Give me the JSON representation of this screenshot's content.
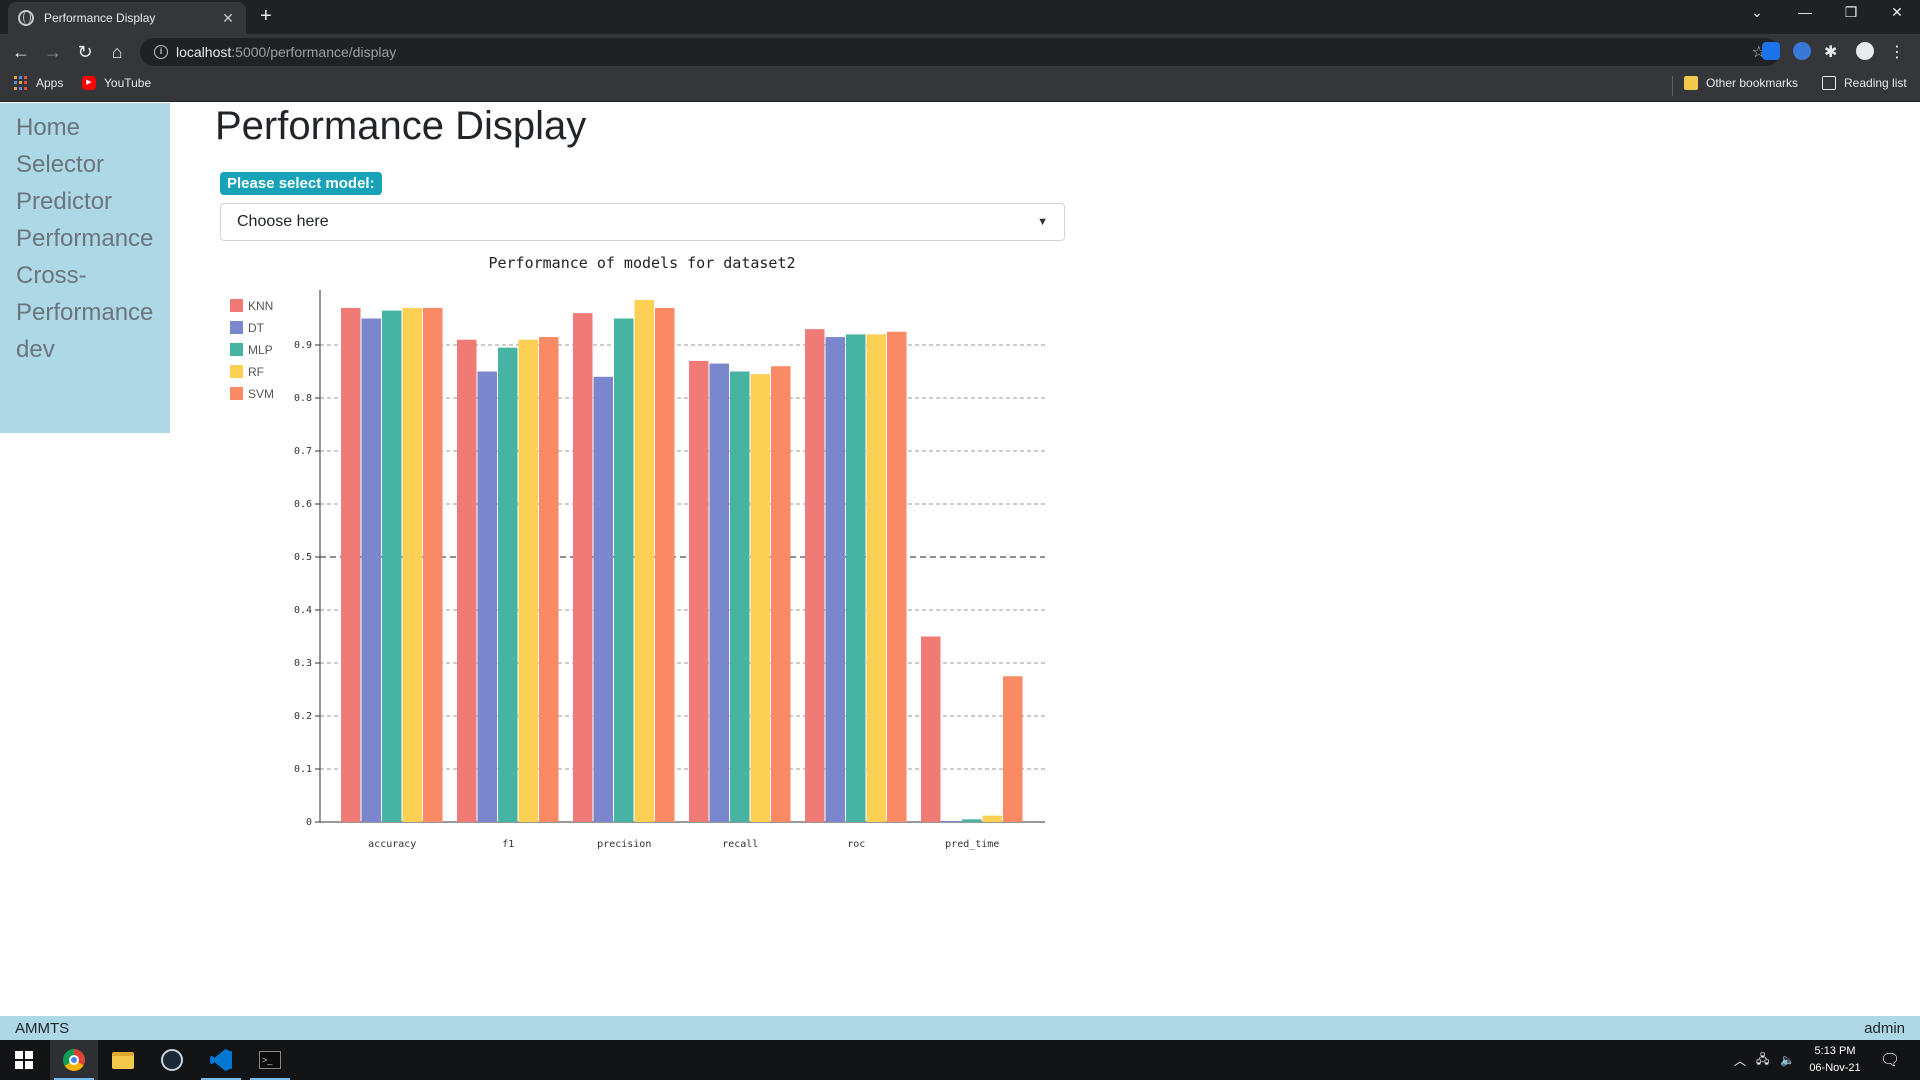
{
  "browser": {
    "tab_title": "Performance Display",
    "tab_close": "✕",
    "new_tab": "+",
    "url_host": "localhost",
    "url_path": ":5000/performance/display",
    "bookmarks": [
      "Apps",
      "YouTube"
    ],
    "other_bookmarks": "Other bookmarks",
    "reading_list": "Reading list"
  },
  "sidebar": {
    "items": [
      "Home",
      "Selector",
      "Predictor",
      "Performance",
      "Cross-",
      "Performance",
      "dev"
    ]
  },
  "page": {
    "title": "Performance Display",
    "select_label": "Please select model:",
    "select_value": "Choose here"
  },
  "footer": {
    "left": "AMMTS",
    "right": "admin"
  },
  "taskbar": {
    "time": "5:13 PM",
    "date": "06-Nov-21"
  },
  "colors": {
    "sidebar_bg": "#add8e6",
    "badge": "#17a2b8",
    "KNN": "#f07a76",
    "DT": "#7a87cc",
    "MLP": "#47b3a3",
    "RF": "#fccf55",
    "SVM": "#fa8a66"
  },
  "chart_data": {
    "type": "bar",
    "title": "Performance of models for dataset2",
    "categories": [
      "accuracy",
      "f1",
      "precision",
      "recall",
      "roc",
      "pred_time"
    ],
    "series": [
      {
        "name": "KNN",
        "values": [
          0.97,
          0.91,
          0.96,
          0.87,
          0.93,
          0.35
        ]
      },
      {
        "name": "DT",
        "values": [
          0.95,
          0.85,
          0.84,
          0.865,
          0.915,
          0.002
        ]
      },
      {
        "name": "MLP",
        "values": [
          0.965,
          0.895,
          0.95,
          0.85,
          0.92,
          0.005
        ]
      },
      {
        "name": "RF",
        "values": [
          0.97,
          0.91,
          0.985,
          0.845,
          0.92,
          0.012
        ]
      },
      {
        "name": "SVM",
        "values": [
          0.97,
          0.915,
          0.97,
          0.86,
          0.925,
          0.275
        ]
      }
    ],
    "yticks": [
      "0",
      "0.1",
      "0.2",
      "0.3",
      "0.4",
      "0.5",
      "0.6",
      "0.7",
      "0.8",
      "0.9"
    ],
    "ylim": [
      0,
      1
    ],
    "legend_position": "top-left",
    "grid": true,
    "reference_line": 0.5
  }
}
